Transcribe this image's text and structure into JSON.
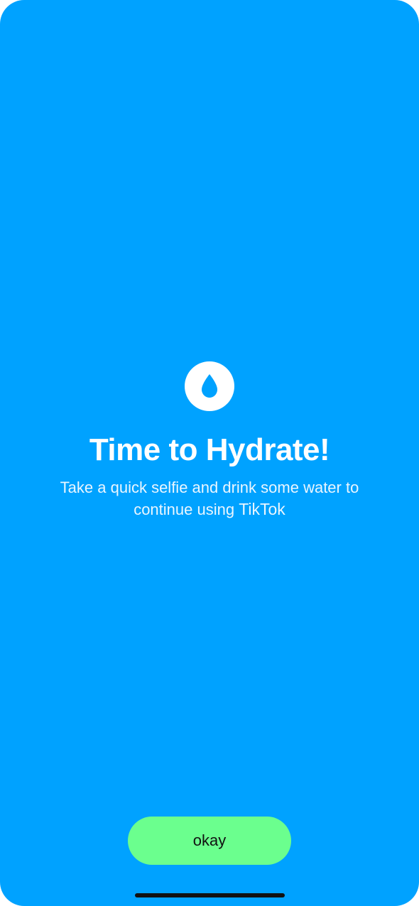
{
  "screen": {
    "background_color": "#00a2ff"
  },
  "badge": {
    "icon": "water-drop-icon",
    "icon_color": "#00a2ff",
    "badge_color": "#ffffff"
  },
  "prompt": {
    "title": "Time to Hydrate!",
    "subtitle_lead": "Take a quick selfie and drink some water to continue using ",
    "app_name": "TikTok"
  },
  "actions": {
    "okay_label": "okay",
    "okay_color": "#6bff8e"
  }
}
